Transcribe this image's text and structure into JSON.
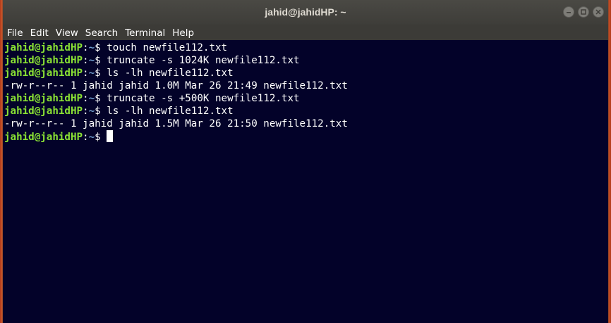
{
  "window": {
    "title": "jahid@jahidHP: ~"
  },
  "menubar": {
    "items": [
      {
        "label": "File"
      },
      {
        "label": "Edit"
      },
      {
        "label": "View"
      },
      {
        "label": "Search"
      },
      {
        "label": "Terminal"
      },
      {
        "label": "Help"
      }
    ]
  },
  "terminal": {
    "prompt": {
      "user_host": "jahid@jahidHP",
      "separator": ":",
      "path": "~",
      "symbol": "$ "
    },
    "lines": [
      {
        "type": "cmd",
        "text": "touch newfile112.txt"
      },
      {
        "type": "cmd",
        "text": "truncate -s 1024K newfile112.txt"
      },
      {
        "type": "cmd",
        "text": "ls -lh newfile112.txt"
      },
      {
        "type": "out",
        "text": "-rw-r--r-- 1 jahid jahid 1.0M Mar 26 21:49 newfile112.txt"
      },
      {
        "type": "cmd",
        "text": "truncate -s +500K newfile112.txt"
      },
      {
        "type": "cmd",
        "text": "ls -lh newfile112.txt"
      },
      {
        "type": "out",
        "text": "-rw-r--r-- 1 jahid jahid 1.5M Mar 26 21:50 newfile112.txt"
      },
      {
        "type": "cmd",
        "text": ""
      }
    ]
  },
  "colors": {
    "terminal_bg": "#030229",
    "prompt_user": "#8ae234",
    "prompt_path": "#729fcf",
    "titlebar_bg": "#3e3d39",
    "desktop_edge": "#c9582a"
  },
  "icons": {
    "minimize": "minimize-icon",
    "maximize": "maximize-icon",
    "close": "close-icon"
  }
}
